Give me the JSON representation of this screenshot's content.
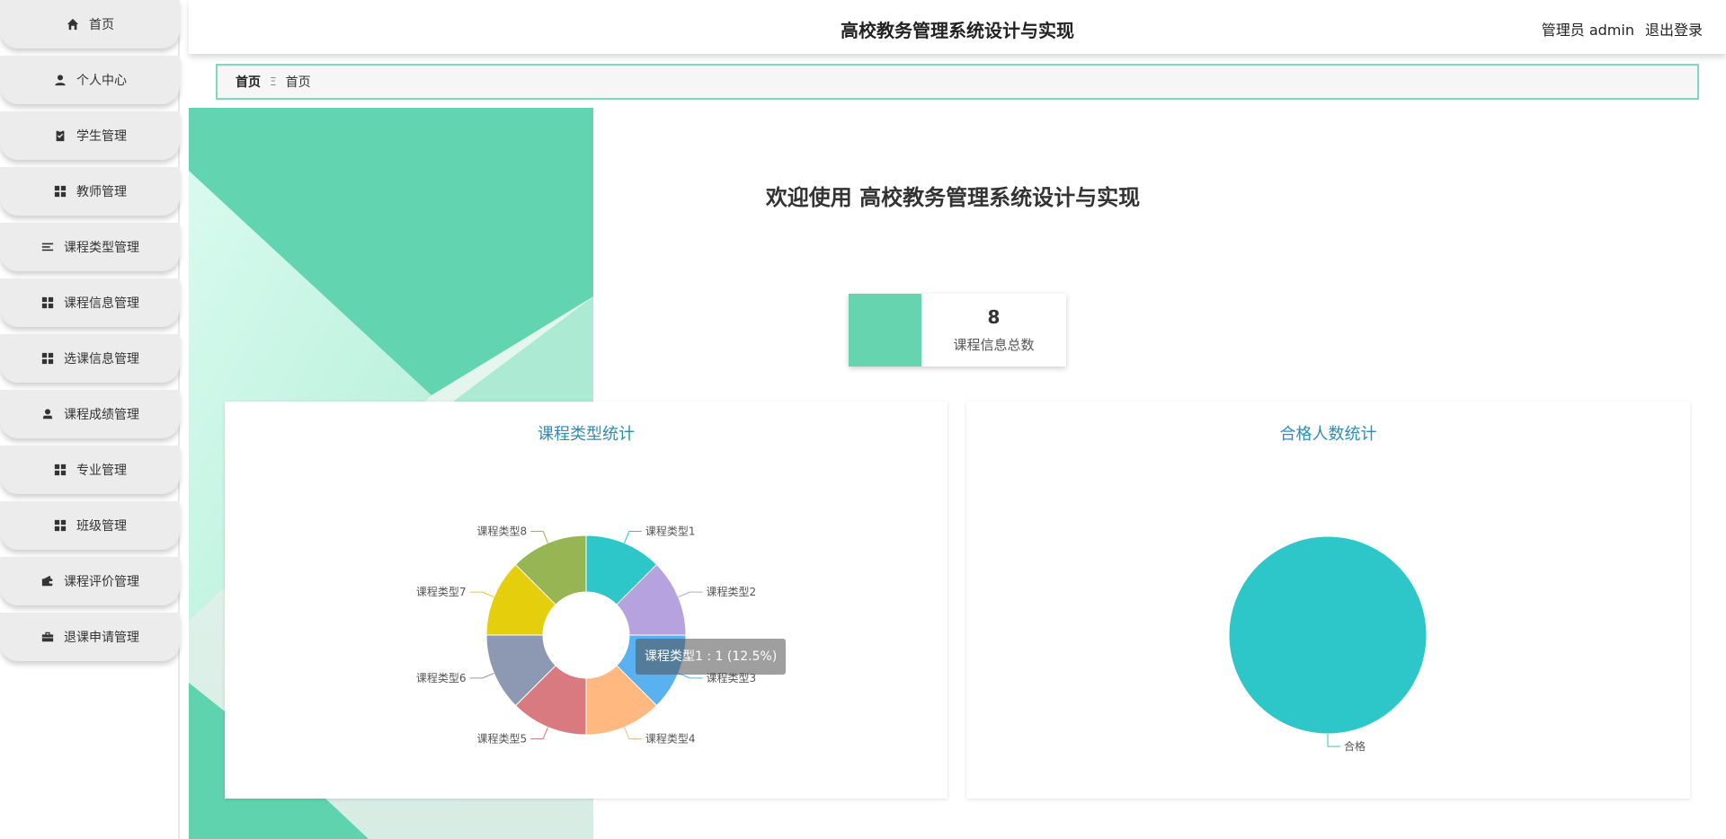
{
  "sidebar": {
    "items": [
      {
        "label": "首页",
        "icon": "home-icon"
      },
      {
        "label": "个人中心",
        "icon": "user-icon"
      },
      {
        "label": "学生管理",
        "icon": "clipboard-check-icon"
      },
      {
        "label": "教师管理",
        "icon": "grid-icon"
      },
      {
        "label": "课程类型管理",
        "icon": "list-icon"
      },
      {
        "label": "课程信息管理",
        "icon": "grid-icon"
      },
      {
        "label": "选课信息管理",
        "icon": "grid-icon"
      },
      {
        "label": "课程成绩管理",
        "icon": "person-stamp-icon"
      },
      {
        "label": "专业管理",
        "icon": "grid-icon"
      },
      {
        "label": "班级管理",
        "icon": "grid-icon"
      },
      {
        "label": "课程评价管理",
        "icon": "wallet-icon"
      },
      {
        "label": "退课申请管理",
        "icon": "briefcase-icon"
      }
    ]
  },
  "header": {
    "title": "高校教务管理系统设计与实现",
    "user": "管理员 admin",
    "logout": "退出登录"
  },
  "breadcrumb": {
    "home": "首页",
    "separator": "Ξ",
    "current": "首页"
  },
  "welcome": "欢迎使用 高校教务管理系统设计与实现",
  "stat": {
    "value": "8",
    "label": "课程信息总数",
    "color": "#67d4b0"
  },
  "tooltip": "课程类型1 : 1 (12.5%)",
  "chart_data": [
    {
      "type": "pie",
      "variant": "donut",
      "title": "课程类型统计",
      "categories": [
        "课程类型1",
        "课程类型2",
        "课程类型3",
        "课程类型4",
        "课程类型5",
        "课程类型6",
        "课程类型7",
        "课程类型8"
      ],
      "values": [
        1,
        1,
        1,
        1,
        1,
        1,
        1,
        1
      ],
      "colors": [
        "#2ec7c9",
        "#b6a2de",
        "#5ab1ef",
        "#ffb980",
        "#d87a80",
        "#8d98b3",
        "#e5cf0d",
        "#97b552"
      ]
    },
    {
      "type": "pie",
      "title": "合格人数统计",
      "categories": [
        "合格"
      ],
      "values": [
        1
      ],
      "colors": [
        "#2ec7c9"
      ]
    }
  ]
}
